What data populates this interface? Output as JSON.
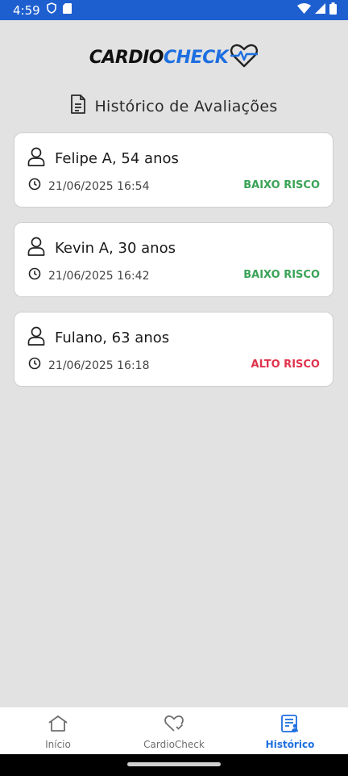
{
  "status_bar": {
    "time": "4:59",
    "bg_color": "#1e5fd0"
  },
  "logo": {
    "part1": "CARDIO",
    "part2": "CHECK",
    "accent": "#1e6fe0"
  },
  "page": {
    "title": "Histórico de Avaliações"
  },
  "evaluations": [
    {
      "name": "Felipe A, 54 anos",
      "datetime": "21/06/2025 16:54",
      "risk": "BAIXO RISCO",
      "risk_color": "#3aa357"
    },
    {
      "name": "Kevin A, 30 anos",
      "datetime": "21/06/2025 16:42",
      "risk": "BAIXO RISCO",
      "risk_color": "#3aa357"
    },
    {
      "name": "Fulano, 63 anos",
      "datetime": "21/06/2025 16:18",
      "risk": "ALTO RISCO",
      "risk_color": "#e0334d"
    }
  ],
  "bottom_nav": [
    {
      "label": "Início",
      "icon": "home-icon",
      "active": false
    },
    {
      "label": "CardioCheck",
      "icon": "heart-check-icon",
      "active": false
    },
    {
      "label": "Histórico",
      "icon": "history-list-icon",
      "active": true
    }
  ]
}
